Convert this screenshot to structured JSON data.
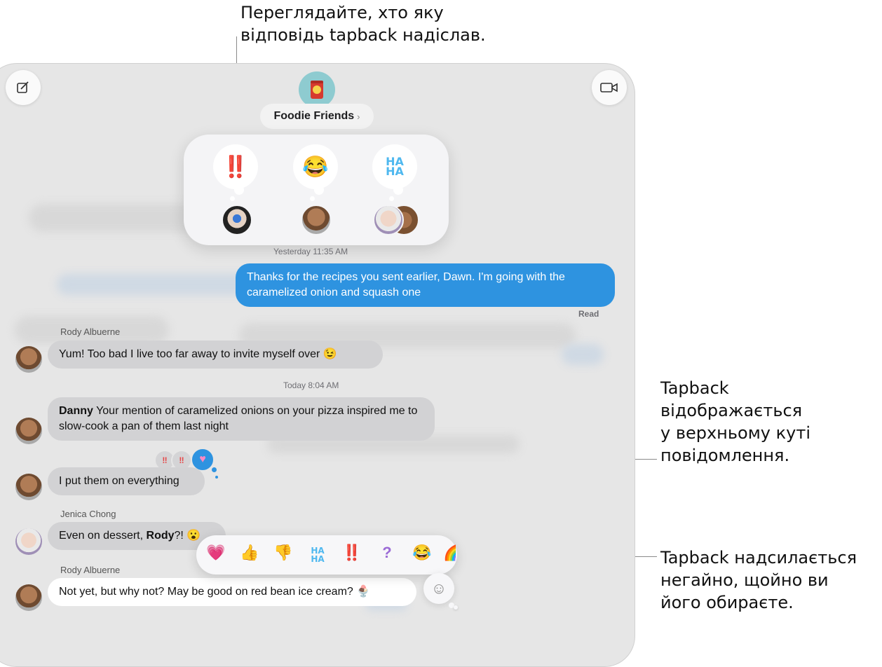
{
  "callouts": {
    "top": "Переглядайте, хто яку\nвідповідь tapback надіслав.",
    "middle": "Tapback\nвідображається\nу верхньому куті\nповідомлення.",
    "bottom": "Tapback надсилається\nнегайно, щойно ви\nйого обираєте."
  },
  "conversation": {
    "name": "Foodie Friends",
    "chevron": "›"
  },
  "tapback_detail": {
    "reactions": [
      {
        "emoji": "‼️",
        "icon": "exclamation-icon"
      },
      {
        "emoji": "😂",
        "icon": "laughing-emoji-icon"
      },
      {
        "emoji": "HA\nHA",
        "icon": "haha-icon"
      }
    ]
  },
  "messages": {
    "ts_yesterday": "Yesterday 11:35 AM",
    "outgoing_1": "Thanks for the recipes you sent earlier, Dawn. I'm going with the caramelized onion and squash one",
    "read_receipt": "Read",
    "sender_rody_1": "Rody Albuerne",
    "rody_1": "Yum! Too bad I live too far away to invite myself over 😉",
    "ts_today": "Today 8:04 AM",
    "rody_2_mention": "Danny",
    "rody_2": " Your mention of caramelized onions on your pizza inspired me to slow-cook a pan of them last night",
    "rody_3": "I put them on everything",
    "sender_jenica": "Jenica Chong",
    "jenica_1_pre": "Even on dessert, ",
    "jenica_1_mention": "Rody",
    "jenica_1_post": "?! 😮",
    "sender_rody_2": "Rody Albuerne",
    "rody_4": "Not yet, but why not? May be good on red bean ice cream? 🍨"
  },
  "message_tapbacks": {
    "exclaim_1": "‼",
    "exclaim_2": "‼",
    "heart": "♥"
  },
  "picker": {
    "heart": "💗",
    "thumbs_up": "👍",
    "thumbs_down": "👎",
    "haha": "HA\nHA",
    "exclaim": "‼️",
    "question": "?",
    "laugh": "😂",
    "rainbow": "🌈",
    "emoji_button": "☺"
  },
  "colors": {
    "outgoing_bubble": "#2e93e0",
    "incoming_bubble": "#d2d2d4",
    "window_bg": "#e6e6e6"
  }
}
